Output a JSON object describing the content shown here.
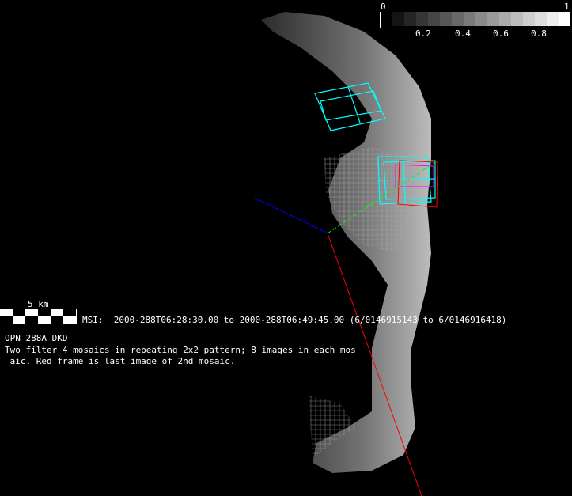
{
  "colorbar": {
    "min_label": "0",
    "max_label": "1",
    "ticks": [
      "0.2",
      "0.4",
      "0.6",
      "0.8"
    ],
    "steps": 15
  },
  "scale_bar": {
    "label": "5 km"
  },
  "info": {
    "msi_line": "MSI:  2000-288T06:28:30.00 to 2000-288T06:49:45.00 (6/0146915143 to 6/0146916418)",
    "sequence_name": "OPN_288A_DKD",
    "description_line1": "Two filter 4 mosaics in repeating 2x2 pattern; 8 images in each mos",
    "description_line2": " aic. Red frame is last image of 2nd mosaic."
  },
  "colors": {
    "footprint": "#00ffff",
    "last_frame": "#ff0000",
    "axis_x": "#ff0000",
    "axis_y": "#00ff00",
    "axis_z": "#0000ff",
    "magenta": "#ff00ff"
  }
}
